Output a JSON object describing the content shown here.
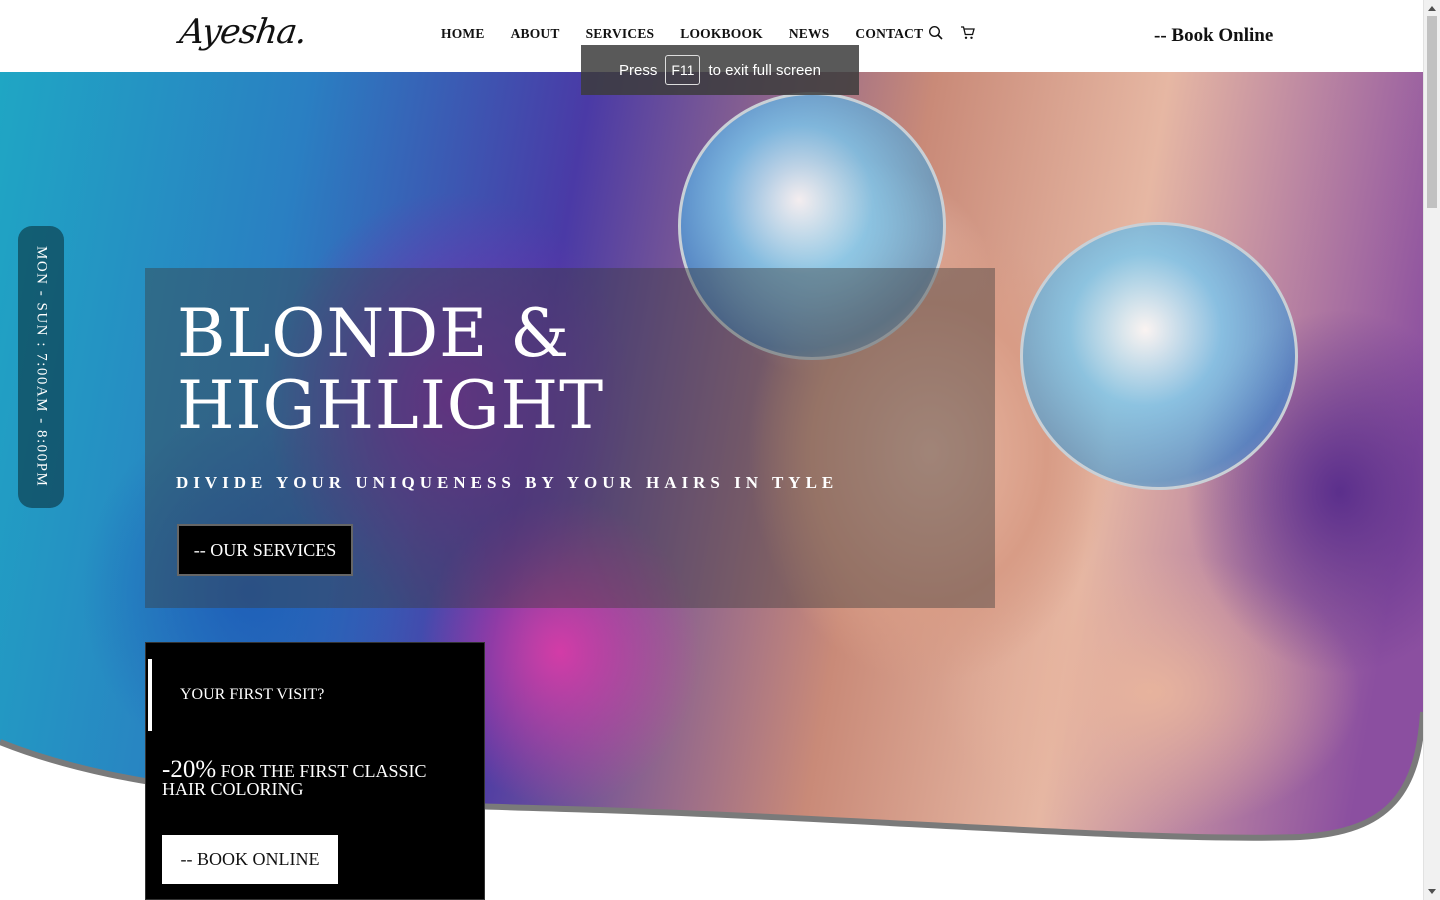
{
  "header": {
    "logo": "Ayesha.",
    "nav": [
      "HOME",
      "ABOUT",
      "SERVICES",
      "LOOKBOOK",
      "NEWS",
      "CONTACT"
    ],
    "book_online": "-- Book Online"
  },
  "fullscreen_notice": {
    "prefix": "Press",
    "key": "F11",
    "suffix": "to exit full screen"
  },
  "hours": "MON - SUN : 7:00AM - 8:00PM",
  "hero": {
    "title_line1": "BLONDE &",
    "title_line2": "HIGHLIGHT",
    "subtitle": "DIVIDE YOUR UNIQUENESS BY YOUR HAIRS IN TYLE",
    "services_button": "-- OUR SERVICES"
  },
  "first_visit": {
    "title": "YOUR FIRST VISIT?",
    "percent": "-20%",
    "offer": "FOR THE FIRST CLASSIC HAIR COLORING",
    "button": "-- BOOK ONLINE"
  },
  "colors": {
    "accent": "#000000",
    "panel_overlay": "rgba(60,60,60,0.42)",
    "curve_shadow": "#7a7a7a"
  },
  "icons": [
    "search-icon",
    "cart-icon"
  ]
}
